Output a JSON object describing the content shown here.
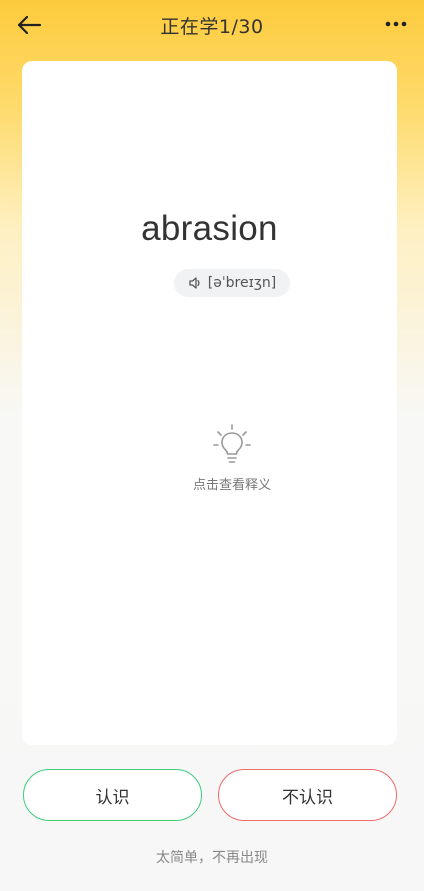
{
  "header": {
    "back_icon": "arrow-left-icon",
    "title": "正在学1/30",
    "more_icon": "more-horizontal-icon"
  },
  "card": {
    "word": "abrasion",
    "phonetic": "[əˈbreɪʒn]",
    "speaker_icon": "speaker-icon",
    "hint_icon": "lightbulb-icon",
    "hint_text": "点击查看释义"
  },
  "actions": {
    "know_label": "认识",
    "unknown_label": "不认识",
    "skip_label": "太简单，不再出现"
  },
  "colors": {
    "header_gradient_top": "#FDCB3C",
    "know_border": "#3FCB7A",
    "unknown_border": "#EE6B6B",
    "phonetic_bg": "#F1F2F4"
  }
}
